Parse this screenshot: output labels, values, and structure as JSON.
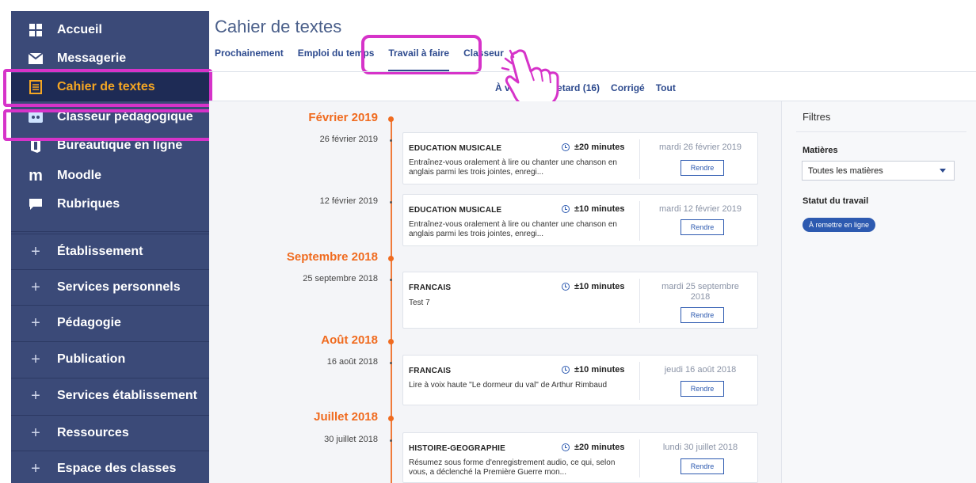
{
  "sidebar": {
    "nav": [
      {
        "label": "Accueil",
        "icon": "grid-icon"
      },
      {
        "label": "Messagerie",
        "icon": "envelope-icon"
      },
      {
        "label": "Cahier de textes",
        "icon": "notebook-icon"
      },
      {
        "label": "Classeur pédagogique",
        "icon": "binder-icon"
      },
      {
        "label": "Bureautique en ligne",
        "icon": "office-icon"
      },
      {
        "label": "Moodle",
        "icon": "moodle-icon"
      },
      {
        "label": "Rubriques",
        "icon": "chat-icon"
      }
    ],
    "sections": [
      {
        "label": "Établissement"
      },
      {
        "label": "Services personnels"
      },
      {
        "label": "Pédagogie"
      },
      {
        "label": "Publication"
      },
      {
        "label": "Services établissement"
      },
      {
        "label": "Ressources"
      },
      {
        "label": "Espace des classes"
      }
    ],
    "plus_symbol": "+",
    "active_color": "#f5a623",
    "bg_color": "#3b4a78"
  },
  "header": {
    "title": "Cahier de textes",
    "tabs": [
      {
        "label": "Prochainement"
      },
      {
        "label": "Emploi du temps"
      },
      {
        "label": "Travail à faire"
      },
      {
        "label": "Classeur"
      }
    ]
  },
  "subtabs": [
    {
      "label": "À venir"
    },
    {
      "label": "En retard (16)"
    },
    {
      "label": "Corrigé"
    },
    {
      "label": "Tout"
    }
  ],
  "timeline": {
    "accent_color": "#f06b1f",
    "months": [
      {
        "label": "Février 2019"
      },
      {
        "label": "Septembre 2018"
      },
      {
        "label": "Août 2018"
      },
      {
        "label": "Juillet 2018"
      }
    ],
    "entries": [
      {
        "date": "26 février 2019",
        "subject": "EDUCATION MUSICALE",
        "duration": "±20 minutes",
        "description": "Entraînez-vous oralement à lire ou chanter une chanson en anglais parmi les trois jointes, enregi...",
        "due": "mardi 26 février 2019",
        "button": "Rendre"
      },
      {
        "date": "12 février 2019",
        "subject": "EDUCATION MUSICALE",
        "duration": "±10 minutes",
        "description": "Entraînez-vous oralement à lire ou chanter une chanson en anglais parmi les trois jointes, enregi...",
        "due": "mardi 12 février 2019",
        "button": "Rendre"
      },
      {
        "date": "25 septembre 2018",
        "subject": "FRANCAIS",
        "duration": "±10 minutes",
        "description": "Test 7",
        "due": "mardi 25 septembre 2018",
        "button": "Rendre"
      },
      {
        "date": "16 août 2018",
        "subject": "FRANCAIS",
        "duration": "±10 minutes",
        "description": "Lire à voix haute \"Le dormeur du val\" de Arthur Rimbaud",
        "due": "jeudi 16 août 2018",
        "button": "Rendre"
      },
      {
        "date": "30 juillet 2018",
        "subject": "HISTOIRE-GEOGRAPHIE",
        "duration": "±20 minutes",
        "description": "Résumez sous forme d'enregistrement audio, ce qui, selon vous, a déclenché la Première Guerre mon...",
        "due": "lundi 30 juillet 2018",
        "button": "Rendre"
      }
    ]
  },
  "filters": {
    "title": "Filtres",
    "subjects_label": "Matières",
    "subjects_value": "Toutes les matières",
    "status_label": "Statut du travail",
    "status_pill": "À remettre en ligne"
  },
  "annotations": {
    "highlight_color": "#d633c9"
  }
}
